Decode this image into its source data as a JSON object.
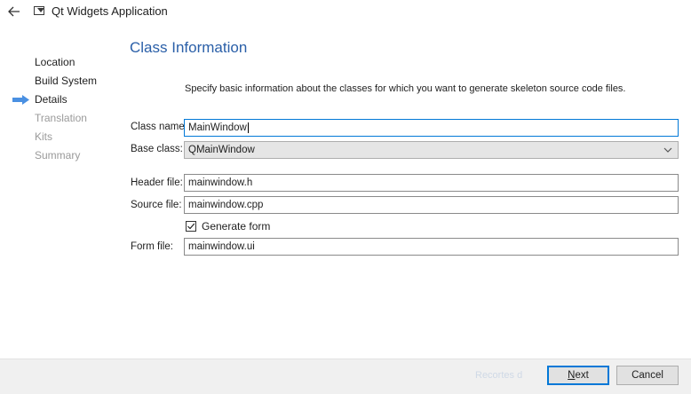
{
  "window": {
    "title": "Qt Widgets Application"
  },
  "steps": [
    {
      "label": "Location",
      "state": "done"
    },
    {
      "label": "Build System",
      "state": "done"
    },
    {
      "label": "Details",
      "state": "current"
    },
    {
      "label": "Translation",
      "state": "pending"
    },
    {
      "label": "Kits",
      "state": "pending"
    },
    {
      "label": "Summary",
      "state": "pending"
    }
  ],
  "page": {
    "title": "Class Information",
    "description": "Specify basic information about the classes for which you want to generate skeleton source code files."
  },
  "form": {
    "class_name_label": "Class name:",
    "class_name_value": "MainWindow",
    "base_class_label": "Base class:",
    "base_class_value": "QMainWindow",
    "header_file_label": "Header file:",
    "header_file_value": "mainwindow.h",
    "source_file_label": "Source file:",
    "source_file_value": "mainwindow.cpp",
    "generate_form_label": "Generate form",
    "generate_form_checked": true,
    "form_file_label": "Form file:",
    "form_file_value": "mainwindow.ui"
  },
  "buttons": {
    "back_label": "Recortes d",
    "next_label_prefix": "",
    "next_label_mnemonic": "N",
    "next_label_rest": "ext",
    "cancel_label": "Cancel"
  },
  "colors": {
    "accent": "#0078d7",
    "title_blue": "#2a5fa8",
    "step_arrow": "#4a90e2",
    "disabled_text": "#9a9a9a"
  },
  "icons": {
    "back": "back-arrow-icon",
    "app": "qt-app-window-icon",
    "current_step": "current-step-arrow-icon",
    "dropdown": "chevron-down-icon",
    "checkbox": "checkmark-icon"
  }
}
